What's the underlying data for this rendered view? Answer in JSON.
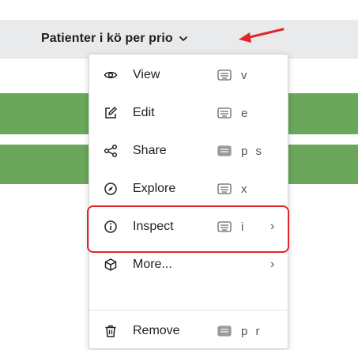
{
  "panel": {
    "title": "Patienter i kö per prio"
  },
  "colors": {
    "header_bg": "#e9eaec",
    "bar_green": "#6aa75b",
    "annotation_red": "#e0262b"
  },
  "menu": {
    "items": [
      {
        "label": "View",
        "icon": "eye-icon",
        "shortcut": "v",
        "submenu": ""
      },
      {
        "label": "Edit",
        "icon": "edit-icon",
        "shortcut": "e",
        "submenu": ""
      },
      {
        "label": "Share",
        "icon": "share-icon",
        "shortcut": "p s",
        "submenu": ""
      },
      {
        "label": "Explore",
        "icon": "compass-icon",
        "shortcut": "x",
        "submenu": ""
      },
      {
        "label": "Inspect",
        "icon": "info-icon",
        "shortcut": "i",
        "submenu": "›"
      },
      {
        "label": "More...",
        "icon": "cube-icon",
        "shortcut": "",
        "submenu": "›"
      },
      {
        "label": "Remove",
        "icon": "trash-icon",
        "shortcut": "p r",
        "submenu": ""
      }
    ]
  }
}
